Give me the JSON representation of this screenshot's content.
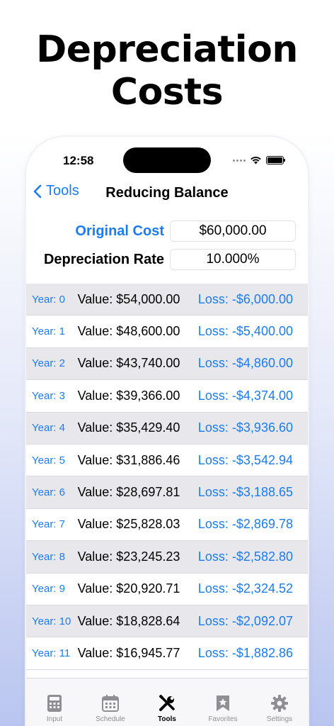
{
  "headline": {
    "line1": "Depreciation",
    "line2": "Costs"
  },
  "status": {
    "time": "12:58"
  },
  "nav": {
    "back_label": "Tools",
    "title": "Reducing Balance"
  },
  "form": {
    "original_cost_label": "Original Cost",
    "original_cost_value": "$60,000.00",
    "depreciation_rate_label": "Depreciation Rate",
    "depreciation_rate_value": "10.000%"
  },
  "rows": [
    {
      "year": "Year: 0",
      "value": "Value: $54,000.00",
      "loss": "Loss: -$6,000.00"
    },
    {
      "year": "Year: 1",
      "value": "Value: $48,600.00",
      "loss": "Loss: -$5,400.00"
    },
    {
      "year": "Year: 2",
      "value": "Value: $43,740.00",
      "loss": "Loss: -$4,860.00"
    },
    {
      "year": "Year: 3",
      "value": "Value: $39,366.00",
      "loss": "Loss: -$4,374.00"
    },
    {
      "year": "Year: 4",
      "value": "Value: $35,429.40",
      "loss": "Loss: -$3,936.60"
    },
    {
      "year": "Year: 5",
      "value": "Value: $31,886.46",
      "loss": "Loss: -$3,542.94"
    },
    {
      "year": "Year: 6",
      "value": "Value: $28,697.81",
      "loss": "Loss: -$3,188.65"
    },
    {
      "year": "Year: 7",
      "value": "Value: $25,828.03",
      "loss": "Loss: -$2,869.78"
    },
    {
      "year": "Year: 8",
      "value": "Value: $23,245.23",
      "loss": "Loss: -$2,582.80"
    },
    {
      "year": "Year: 9",
      "value": "Value: $20,920.71",
      "loss": "Loss: -$2,324.52"
    },
    {
      "year": "Year: 10",
      "value": "Value: $18,828.64",
      "loss": "Loss: -$2,092.07"
    },
    {
      "year": "Year: 11",
      "value": "Value: $16,945.77",
      "loss": "Loss: -$1,882.86"
    }
  ],
  "tabs": [
    {
      "label": "Input",
      "icon": "calculator-icon"
    },
    {
      "label": "Schedule",
      "icon": "calendar-icon"
    },
    {
      "label": "Tools",
      "icon": "tools-icon",
      "active": true
    },
    {
      "label": "Favorites",
      "icon": "bookmark-icon"
    },
    {
      "label": "Settings",
      "icon": "gear-icon"
    }
  ],
  "colors": {
    "accent": "#1a7cf0",
    "row_alt": "#e8e8ec",
    "tab_inactive": "#8e8e93"
  }
}
